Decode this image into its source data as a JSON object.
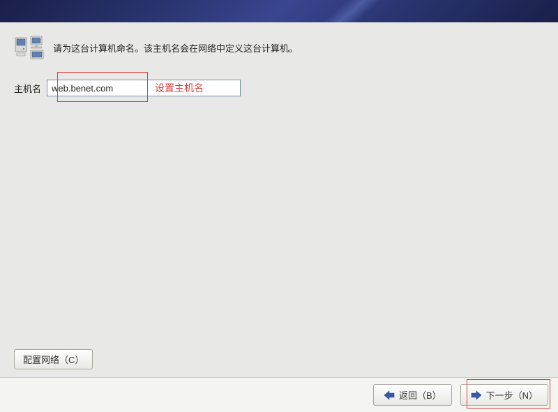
{
  "instruction": "请为这台计算机命名。该主机名会在网络中定义这台计算机。",
  "hostname": {
    "label": "主机名",
    "value": "web.benet.com"
  },
  "annotation": "设置主机名",
  "buttons": {
    "configure_network": "配置网络（C）",
    "back": "返回（B）",
    "next": "下一步（N）"
  }
}
